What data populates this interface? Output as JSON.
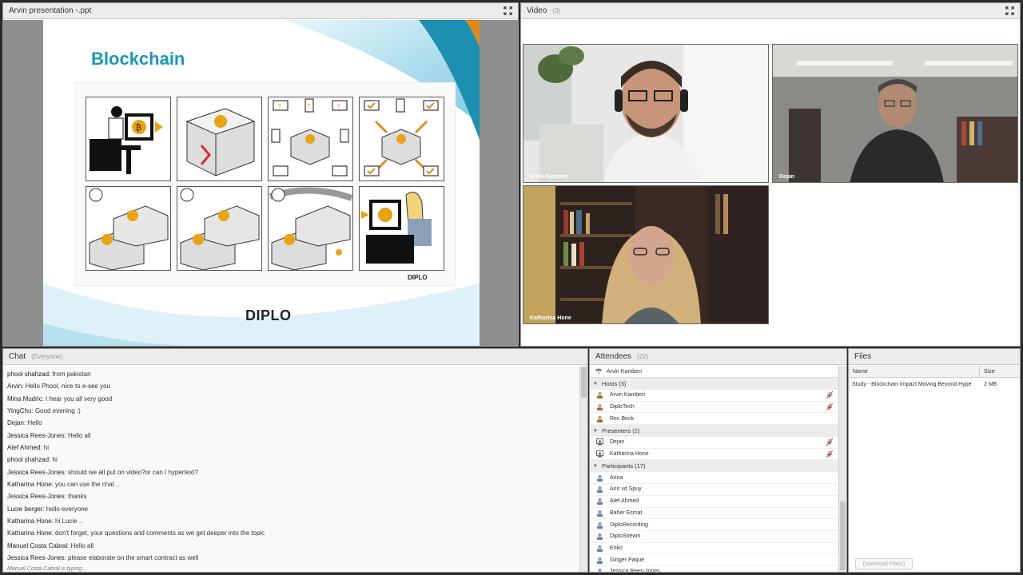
{
  "share": {
    "title": "Arvin presentation -.ppt",
    "slide_title": "Blockchain",
    "logo": "DIPLO",
    "logo_small": "DIPLO"
  },
  "video": {
    "title": "Video",
    "count": "(3)",
    "feeds": [
      {
        "name": "Arvin Kamberi"
      },
      {
        "name": "Dejan"
      },
      {
        "name": "Katharina Hone"
      }
    ]
  },
  "chat": {
    "title": "Chat",
    "scope": "(Everyone)",
    "messages": [
      {
        "sender": "phool shahzad",
        "text": ": from pakistan"
      },
      {
        "sender": "Arvin",
        "text": ": Hello Phool, nice to e-see you"
      },
      {
        "sender": "Mina Mudric",
        "text": ": I hear you all very good"
      },
      {
        "sender": "YingChu",
        "text": ": Good evening :)"
      },
      {
        "sender": "Dejan",
        "text": ": Hello"
      },
      {
        "sender": "Jessica Rees-Jones",
        "text": ": Hello all"
      },
      {
        "sender": "Atef Ahmed",
        "text": ": hi"
      },
      {
        "sender": "phool shahzad",
        "text": ": hi"
      },
      {
        "sender": "Jessica Rees-Jones",
        "text": ": should we all put on video?or can I hypertext?"
      },
      {
        "sender": "Katharina Hone",
        "text": ": you can use the chat .."
      },
      {
        "sender": "Jessica Rees-Jones",
        "text": ": thanks"
      },
      {
        "sender": "Lucie berger",
        "text": ": hello everyone"
      },
      {
        "sender": "Katharina Hone",
        "text": ": hi Lucie .."
      },
      {
        "sender": "Katharina Hone",
        "text": ": don't forget, your questions and comments as we get deeper into the topic"
      },
      {
        "sender": "Manuel Costa Cabral",
        "text": ": Hello all"
      },
      {
        "sender": "Jessica Rees-Jones",
        "text": ": please elaborate on the smart contract as well"
      }
    ],
    "typing": "Manuel Costa Cabral is typing..."
  },
  "attendees": {
    "title": "Attendees",
    "count": "(22)",
    "me": "Arvin Kamberi",
    "hosts_label": "Hosts (3)",
    "hosts": [
      "Arvin Kamberi",
      "DiploTech",
      "Rec Beck"
    ],
    "presenters_label": "Presenters (2)",
    "presenters": [
      "Dejan",
      "Katharina Hone"
    ],
    "participants_label": "Participants (17)",
    "participants": [
      "Anna",
      "Anri vd Spuy",
      "Atef Ahmed",
      "Baher Esmat",
      "DiploRecording",
      "DiploStream",
      "Eriko",
      "Ginger Paque",
      "Jessica Rees-Jones"
    ]
  },
  "files": {
    "title": "Files",
    "col_name": "Name",
    "col_size": "Size",
    "items": [
      {
        "name": "Study - Blockchain Impact Moving Beyond Hype",
        "size": "2 MB"
      }
    ],
    "download_label": "Download File(s)"
  },
  "colors": {
    "slide_title": "#1a97b9",
    "accent_orange": "#e08a1e",
    "bitcoin": "#e8a317"
  }
}
